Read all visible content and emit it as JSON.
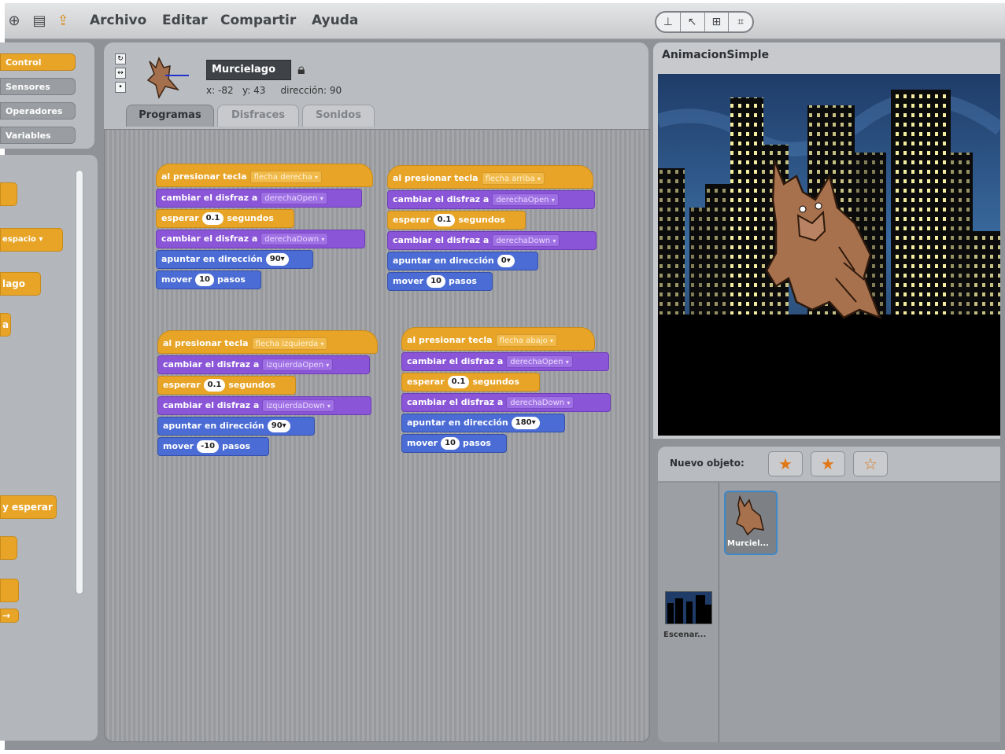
{
  "menu": {
    "icons": [
      "globe-icon",
      "save-icon",
      "share-icon"
    ],
    "items": [
      "Archivo",
      "Editar",
      "Compartir",
      "Ayuda"
    ]
  },
  "view_buttons": [
    "⊥",
    "↖",
    "⊞",
    "⌗"
  ],
  "categories": [
    {
      "label": "Control",
      "active": true
    },
    {
      "label": "Sensores",
      "active": false
    },
    {
      "label": "Operadores",
      "active": false
    },
    {
      "label": "Variables",
      "active": false
    }
  ],
  "palette_blocks": [
    {
      "text": ""
    },
    {
      "text": "espacio ▾"
    },
    {
      "text": "lago"
    },
    {
      "text": "a"
    },
    {
      "text": "y esperar"
    },
    {
      "text": ""
    },
    {
      "text": ""
    },
    {
      "text": "→"
    }
  ],
  "sprite": {
    "name": "Murcielago",
    "x_label": "x:",
    "x": "-82",
    "y_label": "y:",
    "y": "43",
    "dir_label": "dirección:",
    "dir": "90"
  },
  "tabs": [
    {
      "label": "Programas",
      "active": true
    },
    {
      "label": "Disfraces",
      "active": false
    },
    {
      "label": "Sonidos",
      "active": false
    }
  ],
  "scripts": [
    {
      "hat": "al presionar tecla",
      "key": "flecha derecha",
      "costume1": "derechaOpen",
      "wait": "0.1",
      "costume2": "derechaDown",
      "direction": "90",
      "steps": "10"
    },
    {
      "hat": "al presionar tecla",
      "key": "flecha arriba",
      "costume1": "derechaOpen",
      "wait": "0.1",
      "costume2": "derechaDown",
      "direction": "0",
      "steps": "10"
    },
    {
      "hat": "al presionar tecla",
      "key": "flecha izquierda",
      "costume1": "izquierdaOpen",
      "wait": "0.1",
      "costume2": "izquierdaDown",
      "direction": "90",
      "steps": "-10"
    },
    {
      "hat": "al presionar tecla",
      "key": "flecha abajo",
      "costume1": "derechaOpen",
      "wait": "0.1",
      "costume2": "derechaDown",
      "direction": "180",
      "steps": "10"
    }
  ],
  "block_text": {
    "change_costume": "cambiar el disfraz a",
    "wait": "esperar",
    "seconds": "segundos",
    "point_dir": "apuntar en dirección",
    "move": "mover",
    "steps": "pasos"
  },
  "stage": {
    "title": "AnimacionSimple",
    "sky_color": "#2f4e7a",
    "building_color": "#0b0b0b",
    "window_color": "#f5eea0"
  },
  "sprites_panel": {
    "new_object_label": "Nuevo objeto:",
    "new_buttons": [
      "paint-new-sprite-icon",
      "choose-sprite-file-icon",
      "random-sprite-icon"
    ],
    "stage_label": "Escenar...",
    "sprite_label": "Murciel..."
  }
}
